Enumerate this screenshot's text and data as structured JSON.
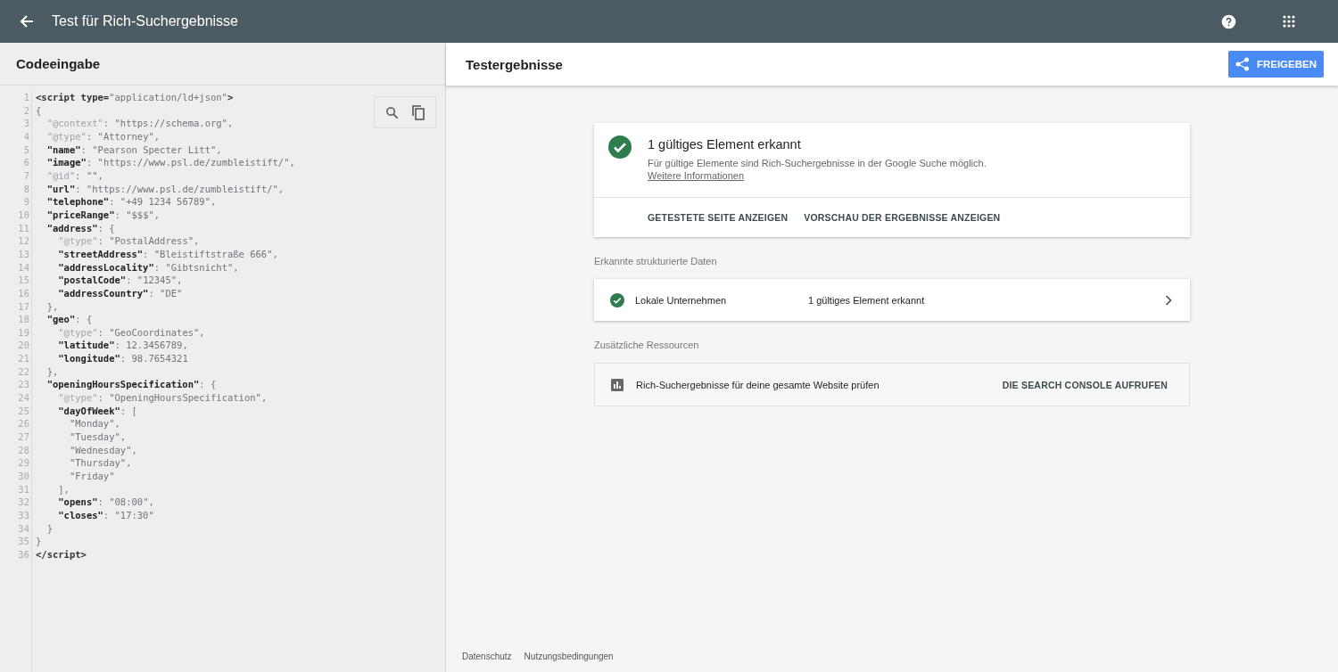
{
  "app_bar": {
    "title": "Test für Rich-Suchergebnisse"
  },
  "code_panel": {
    "title": "Codeeingabe",
    "lines": [
      {
        "number": "1",
        "tokens": [
          {
            "kind": "tag",
            "text": "<script type="
          },
          {
            "kind": "value",
            "text": "\"application/ld+json\""
          },
          {
            "kind": "tag",
            "text": ">"
          }
        ]
      },
      {
        "number": "2",
        "tokens": [
          {
            "kind": "punct",
            "text": "{"
          }
        ]
      },
      {
        "number": "3",
        "tokens": [
          {
            "kind": "meta",
            "text": "  \"@context\""
          },
          {
            "kind": "punct",
            "text": ": "
          },
          {
            "kind": "value",
            "text": "\"https://schema.org\""
          },
          {
            "kind": "punct",
            "text": ","
          }
        ]
      },
      {
        "number": "4",
        "tokens": [
          {
            "kind": "meta",
            "text": "  \"@type\""
          },
          {
            "kind": "punct",
            "text": ": "
          },
          {
            "kind": "value",
            "text": "\"Attorney\""
          },
          {
            "kind": "punct",
            "text": ","
          }
        ]
      },
      {
        "number": "5",
        "tokens": [
          {
            "kind": "key",
            "text": "  \"name\""
          },
          {
            "kind": "punct",
            "text": ": "
          },
          {
            "kind": "value",
            "text": "\"Pearson Specter Litt\""
          },
          {
            "kind": "punct",
            "text": ","
          }
        ]
      },
      {
        "number": "6",
        "tokens": [
          {
            "kind": "key",
            "text": "  \"image\""
          },
          {
            "kind": "punct",
            "text": ": "
          },
          {
            "kind": "value",
            "text": "\"https://www.psl.de/zumbleistift/\""
          },
          {
            "kind": "punct",
            "text": ","
          }
        ]
      },
      {
        "number": "7",
        "tokens": [
          {
            "kind": "meta",
            "text": "  \"@id\""
          },
          {
            "kind": "punct",
            "text": ": "
          },
          {
            "kind": "value",
            "text": "\"\""
          },
          {
            "kind": "punct",
            "text": ","
          }
        ]
      },
      {
        "number": "8",
        "tokens": [
          {
            "kind": "key",
            "text": "  \"url\""
          },
          {
            "kind": "punct",
            "text": ": "
          },
          {
            "kind": "value",
            "text": "\"https://www.psl.de/zumbleistift/\""
          },
          {
            "kind": "punct",
            "text": ","
          }
        ]
      },
      {
        "number": "9",
        "tokens": [
          {
            "kind": "key",
            "text": "  \"telephone\""
          },
          {
            "kind": "punct",
            "text": ": "
          },
          {
            "kind": "value",
            "text": "\"+49 1234 56789\""
          },
          {
            "kind": "punct",
            "text": ","
          }
        ]
      },
      {
        "number": "10",
        "tokens": [
          {
            "kind": "key",
            "text": "  \"priceRange\""
          },
          {
            "kind": "punct",
            "text": ": "
          },
          {
            "kind": "value",
            "text": "\"$$$\""
          },
          {
            "kind": "punct",
            "text": ","
          }
        ]
      },
      {
        "number": "11",
        "tokens": [
          {
            "kind": "key",
            "text": "  \"address\""
          },
          {
            "kind": "punct",
            "text": ": {"
          }
        ]
      },
      {
        "number": "12",
        "tokens": [
          {
            "kind": "meta",
            "text": "    \"@type\""
          },
          {
            "kind": "punct",
            "text": ": "
          },
          {
            "kind": "value",
            "text": "\"PostalAddress\""
          },
          {
            "kind": "punct",
            "text": ","
          }
        ]
      },
      {
        "number": "13",
        "tokens": [
          {
            "kind": "key",
            "text": "    \"streetAddress\""
          },
          {
            "kind": "punct",
            "text": ": "
          },
          {
            "kind": "value",
            "text": "\"Bleistiftstraße 666\""
          },
          {
            "kind": "punct",
            "text": ","
          }
        ]
      },
      {
        "number": "14",
        "tokens": [
          {
            "kind": "key",
            "text": "    \"addressLocality\""
          },
          {
            "kind": "punct",
            "text": ": "
          },
          {
            "kind": "value",
            "text": "\"Gibtsnicht\""
          },
          {
            "kind": "punct",
            "text": ","
          }
        ]
      },
      {
        "number": "15",
        "tokens": [
          {
            "kind": "key",
            "text": "    \"postalCode\""
          },
          {
            "kind": "punct",
            "text": ": "
          },
          {
            "kind": "value",
            "text": "\"12345\""
          },
          {
            "kind": "punct",
            "text": ","
          }
        ]
      },
      {
        "number": "16",
        "tokens": [
          {
            "kind": "key",
            "text": "    \"addressCountry\""
          },
          {
            "kind": "punct",
            "text": ": "
          },
          {
            "kind": "value",
            "text": "\"DE\""
          }
        ]
      },
      {
        "number": "17",
        "tokens": [
          {
            "kind": "punct",
            "text": "  },"
          }
        ]
      },
      {
        "number": "18",
        "tokens": [
          {
            "kind": "key",
            "text": "  \"geo\""
          },
          {
            "kind": "punct",
            "text": ": {"
          }
        ]
      },
      {
        "number": "19",
        "tokens": [
          {
            "kind": "meta",
            "text": "    \"@type\""
          },
          {
            "kind": "punct",
            "text": ": "
          },
          {
            "kind": "value",
            "text": "\"GeoCoordinates\""
          },
          {
            "kind": "punct",
            "text": ","
          }
        ]
      },
      {
        "number": "20",
        "tokens": [
          {
            "kind": "key",
            "text": "    \"latitude\""
          },
          {
            "kind": "punct",
            "text": ": "
          },
          {
            "kind": "value",
            "text": "12.3456789"
          },
          {
            "kind": "punct",
            "text": ","
          }
        ]
      },
      {
        "number": "21",
        "tokens": [
          {
            "kind": "key",
            "text": "    \"longitude\""
          },
          {
            "kind": "punct",
            "text": ": "
          },
          {
            "kind": "value",
            "text": "98.7654321"
          }
        ]
      },
      {
        "number": "22",
        "tokens": [
          {
            "kind": "punct",
            "text": "  },"
          }
        ]
      },
      {
        "number": "23",
        "tokens": [
          {
            "kind": "key",
            "text": "  \"openingHoursSpecification\""
          },
          {
            "kind": "punct",
            "text": ": {"
          }
        ]
      },
      {
        "number": "24",
        "tokens": [
          {
            "kind": "meta",
            "text": "    \"@type\""
          },
          {
            "kind": "punct",
            "text": ": "
          },
          {
            "kind": "value",
            "text": "\"OpeningHoursSpecification\""
          },
          {
            "kind": "punct",
            "text": ","
          }
        ]
      },
      {
        "number": "25",
        "tokens": [
          {
            "kind": "key",
            "text": "    \"dayOfWeek\""
          },
          {
            "kind": "punct",
            "text": ": ["
          }
        ]
      },
      {
        "number": "26",
        "tokens": [
          {
            "kind": "value",
            "text": "      \"Monday\""
          },
          {
            "kind": "punct",
            "text": ","
          }
        ]
      },
      {
        "number": "27",
        "tokens": [
          {
            "kind": "value",
            "text": "      \"Tuesday\""
          },
          {
            "kind": "punct",
            "text": ","
          }
        ]
      },
      {
        "number": "28",
        "tokens": [
          {
            "kind": "value",
            "text": "      \"Wednesday\""
          },
          {
            "kind": "punct",
            "text": ","
          }
        ]
      },
      {
        "number": "29",
        "tokens": [
          {
            "kind": "value",
            "text": "      \"Thursday\""
          },
          {
            "kind": "punct",
            "text": ","
          }
        ]
      },
      {
        "number": "30",
        "tokens": [
          {
            "kind": "value",
            "text": "      \"Friday\""
          }
        ]
      },
      {
        "number": "31",
        "tokens": [
          {
            "kind": "punct",
            "text": "    ],"
          }
        ]
      },
      {
        "number": "32",
        "tokens": [
          {
            "kind": "key",
            "text": "    \"opens\""
          },
          {
            "kind": "punct",
            "text": ": "
          },
          {
            "kind": "value",
            "text": "\"08:00\""
          },
          {
            "kind": "punct",
            "text": ","
          }
        ]
      },
      {
        "number": "33",
        "tokens": [
          {
            "kind": "key",
            "text": "    \"closes\""
          },
          {
            "kind": "punct",
            "text": ": "
          },
          {
            "kind": "value",
            "text": "\"17:30\""
          }
        ]
      },
      {
        "number": "34",
        "tokens": [
          {
            "kind": "punct",
            "text": "  }"
          }
        ]
      },
      {
        "number": "35",
        "tokens": [
          {
            "kind": "punct",
            "text": "}"
          }
        ]
      },
      {
        "number": "36",
        "tokens": [
          {
            "kind": "tag",
            "text": "</script>"
          }
        ]
      }
    ]
  },
  "results_panel": {
    "title": "Testergebnisse",
    "share_button": "FREIGEBEN",
    "summary": {
      "title": "1 gültiges Element erkannt",
      "description": "Für gültige Elemente sind Rich-Suchergebnisse in der Google Suche möglich.",
      "link": "Weitere Informationen",
      "actions": [
        "GETESTETE SEITE ANZEIGEN",
        "VORSCHAU DER ERGEBNISSE ANZEIGEN"
      ]
    },
    "detected_heading": "Erkannte strukturierte Daten",
    "detected": [
      {
        "name": "Lokale Unternehmen",
        "status": "1 gültiges Element erkannt"
      }
    ],
    "resources_heading": "Zusätzliche Ressourcen",
    "resources": [
      {
        "text": "Rich-Suchergebnisse für deine gesamte Website prüfen",
        "action": "DIE SEARCH CONSOLE AUFRUFEN"
      }
    ]
  },
  "footer": {
    "links": [
      "Datenschutz",
      "Nutzungsbedingungen"
    ]
  }
}
